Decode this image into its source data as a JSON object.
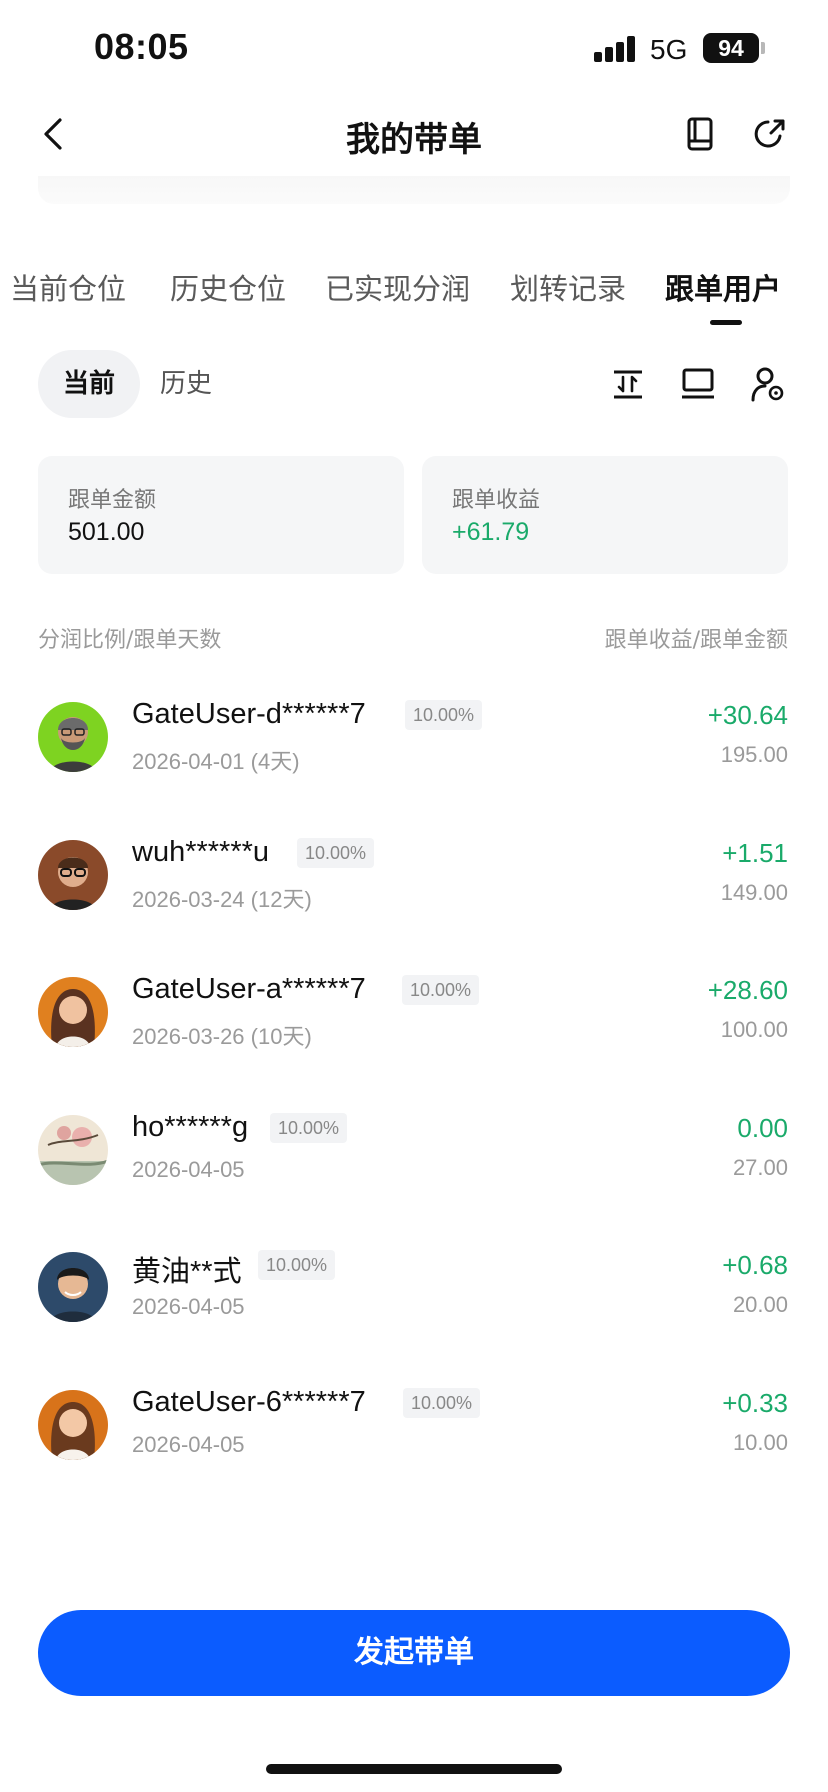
{
  "status_bar": {
    "time": "08:05",
    "network": "5G",
    "battery": "94"
  },
  "header": {
    "title": "我的带单",
    "back_icon": "chevron-left-icon",
    "book_icon": "book-icon",
    "share_icon": "share-icon"
  },
  "tabs": [
    {
      "label": "当前仓位"
    },
    {
      "label": "历史仓位"
    },
    {
      "label": "已实现分润"
    },
    {
      "label": "划转记录"
    },
    {
      "label": "跟单用户",
      "active": true
    }
  ],
  "subtabs": {
    "current": "当前",
    "history": "历史"
  },
  "tools": {
    "sort_icon": "sort-icon",
    "monitor_icon": "monitor-icon",
    "user_settings_icon": "user-settings-icon"
  },
  "stats": {
    "follow_amount_label": "跟单金额",
    "follow_amount_value": "501.00",
    "follow_profit_label": "跟单收益",
    "follow_profit_value": "+61.79"
  },
  "list_header": {
    "left": "分润比例/跟单天数",
    "right": "跟单收益/跟单金额"
  },
  "followers": [
    {
      "name": "GateUser-d******7",
      "ratio": "10.00%",
      "date": "2026-04-01 (4天)",
      "profit": "+30.64",
      "amount": "195.00"
    },
    {
      "name": "wuh******u",
      "ratio": "10.00%",
      "date": "2026-03-24 (12天)",
      "profit": "+1.51",
      "amount": "149.00"
    },
    {
      "name": "GateUser-a******7",
      "ratio": "10.00%",
      "date": "2026-03-26 (10天)",
      "profit": "+28.60",
      "amount": "100.00"
    },
    {
      "name": "ho******g",
      "ratio": "10.00%",
      "date": "2026-04-05",
      "profit": "0.00",
      "amount": "27.00"
    },
    {
      "name": "黄油**式",
      "ratio": "10.00%",
      "date": "2026-04-05",
      "profit": "+0.68",
      "amount": "20.00"
    },
    {
      "name": "GateUser-6******7",
      "ratio": "10.00%",
      "date": "2026-04-05",
      "profit": "+0.33",
      "amount": "10.00"
    }
  ],
  "cta": {
    "label": "发起带单"
  },
  "colors": {
    "accent": "#0b5cff",
    "profit_green": "#1aaa6a"
  }
}
